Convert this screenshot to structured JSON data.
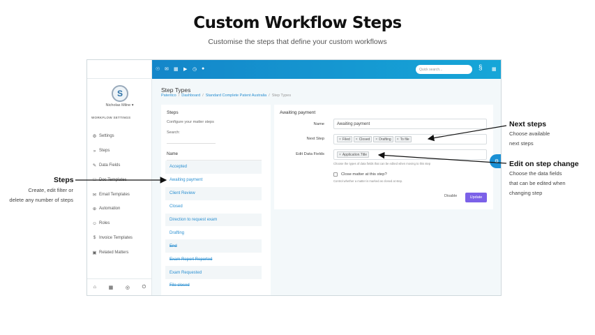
{
  "hero": {
    "title": "Custom Workflow Steps",
    "subtitle": "Customise the steps that define your custom workflows"
  },
  "topbar": {
    "icons": [
      "home-icon",
      "mail-icon",
      "calendar-icon",
      "play-icon",
      "clock-icon",
      "user-icon"
    ],
    "search_placeholder": "Quick search...",
    "right_icons": [
      "logo-icon",
      "grid-icon"
    ]
  },
  "sidebar": {
    "avatar_initial": "S",
    "user_name": "Nicholas Milne ▾",
    "section_title": "WORKFLOW SETTINGS",
    "items": [
      {
        "label": "Settings",
        "icon": "⚙"
      },
      {
        "label": "Steps",
        "icon": "»"
      },
      {
        "label": "Data Fields",
        "icon": "✎"
      },
      {
        "label": "Doc Templates",
        "icon": "□"
      },
      {
        "label": "Email Templates",
        "icon": "✉"
      },
      {
        "label": "Automation",
        "icon": "⊕"
      },
      {
        "label": "Roles",
        "icon": "☺"
      },
      {
        "label": "Invoice Templates",
        "icon": "$"
      },
      {
        "label": "Related Matters",
        "icon": "▣"
      }
    ],
    "bottom_icons": [
      "⌂",
      "▦",
      "◎",
      "⏻"
    ]
  },
  "page": {
    "title": "Step Types",
    "breadcrumb": [
      "Patentco",
      "Dashboard",
      "Standard Complete Patent Australia",
      "Step Types"
    ]
  },
  "steps_panel": {
    "title": "Steps",
    "description": "Configure your matter steps",
    "search_label": "Search:",
    "column_header": "Name",
    "steps": [
      {
        "name": "Accepted",
        "struck": false
      },
      {
        "name": "Awaiting payment",
        "struck": false
      },
      {
        "name": "Client Review",
        "struck": false
      },
      {
        "name": "Closed",
        "struck": false
      },
      {
        "name": "Direction to request exam",
        "struck": false
      },
      {
        "name": "Drafting",
        "struck": false
      },
      {
        "name": "End",
        "struck": true
      },
      {
        "name": "Exam Report Reported",
        "struck": true
      },
      {
        "name": "Exam Requested",
        "struck": false
      },
      {
        "name": "File closed",
        "struck": true
      }
    ]
  },
  "detail": {
    "title": "Awaiting payment",
    "name_label": "Name",
    "name_value": "Awaiting payment",
    "next_step_label": "Next Step",
    "next_steps": [
      "Filed",
      "Closed",
      "Drafting",
      "To file"
    ],
    "edit_fields_label": "Edit Data Fields",
    "edit_fields": [
      "Application.Title"
    ],
    "edit_fields_help": "Choose the types of data fields that can be edited when moving to this step",
    "close_label": "Close matter at this step?",
    "close_help": "Control whether a matter is marked as closed at step.",
    "disable_label": "Disable",
    "update_label": "Update"
  },
  "annotations": {
    "steps": {
      "title": "Steps",
      "lines": [
        "Create, edit filter or",
        "delete any number of steps"
      ]
    },
    "next_steps": {
      "title": "Next steps",
      "lines": [
        "Choose available",
        "next steps"
      ]
    },
    "edit_on_change": {
      "title": "Edit on step change",
      "lines": [
        "Choose the data fields",
        "that can be edited when",
        "changing step"
      ]
    }
  },
  "colors": {
    "topbar": "#1486c9",
    "link": "#2a8fd1",
    "update_button": "#7b61e8"
  }
}
